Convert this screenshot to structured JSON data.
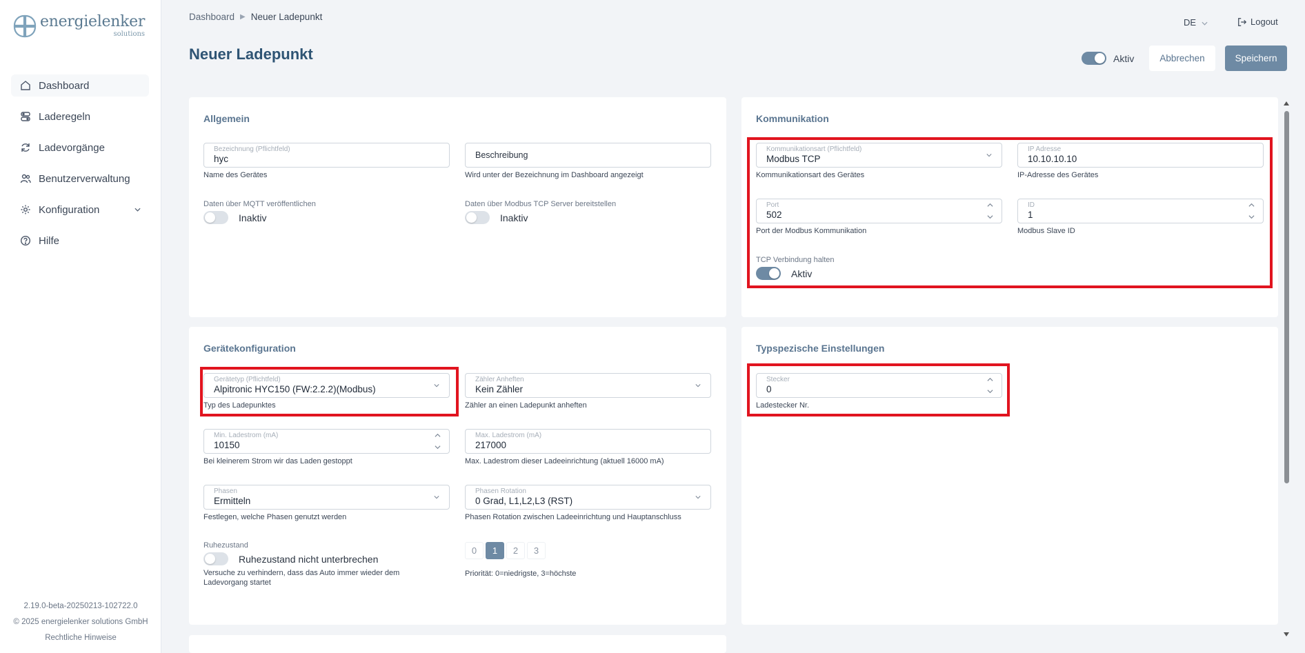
{
  "brand": {
    "name": "energielenker",
    "sub": "solutions"
  },
  "nav": [
    {
      "label": "Dashboard",
      "icon": "home-icon"
    },
    {
      "label": "Laderegeln",
      "icon": "rules-icon"
    },
    {
      "label": "Ladevorgänge",
      "icon": "refresh-icon"
    },
    {
      "label": "Benutzerverwaltung",
      "icon": "users-icon"
    },
    {
      "label": "Konfiguration",
      "icon": "gear-icon"
    },
    {
      "label": "Hilfe",
      "icon": "help-icon"
    }
  ],
  "footer": {
    "version": "2.19.0-beta-20250213-102722.0",
    "copyright": "© 2025 energielenker solutions GmbH",
    "legal": "Rechtliche Hinweise"
  },
  "breadcrumb": {
    "root": "Dashboard",
    "current": "Neuer Ladepunkt"
  },
  "header": {
    "lang": "DE",
    "logout": "Logout"
  },
  "page": {
    "title": "Neuer Ladepunkt",
    "active_label": "Aktiv",
    "cancel": "Abbrechen",
    "save": "Speichern"
  },
  "general": {
    "title": "Allgemein",
    "name": {
      "label": "Bezeichnung (Pflichtfeld)",
      "value": "hyc",
      "helper": "Name des Gerätes"
    },
    "description": {
      "placeholder": "Beschreibung",
      "helper": "Wird unter der Bezeichnung im Dashboard angezeigt"
    },
    "mqtt": {
      "label": "Daten über MQTT veröffentlichen",
      "state": "Inaktiv"
    },
    "modbus_server": {
      "label": "Daten über Modbus TCP Server bereitstellen",
      "state": "Inaktiv"
    }
  },
  "communication": {
    "title": "Kommunikation",
    "type": {
      "label": "Kommunikationsart (Pflichtfeld)",
      "value": "Modbus TCP",
      "helper": "Kommunikationsart des Gerätes"
    },
    "ip": {
      "label": "IP Adresse",
      "value": "10.10.10.10",
      "helper": "IP-Adresse des Gerätes"
    },
    "port": {
      "label": "Port",
      "value": "502",
      "helper": "Port der Modbus Kommunikation"
    },
    "id": {
      "label": "ID",
      "value": "1",
      "helper": "Modbus Slave ID"
    },
    "keep_alive": {
      "label": "TCP Verbindung halten",
      "state": "Aktiv"
    }
  },
  "device": {
    "title": "Gerätekonfiguration",
    "type": {
      "label": "Gerätetyp (Pflichtfeld)",
      "value": "Alpitronic HYC150 (FW:2.2.2)(Modbus)",
      "helper": "Typ des Ladepunktes"
    },
    "meter": {
      "label": "Zähler Anheften",
      "value": "Kein Zähler",
      "helper": "Zähler an einen Ladepunkt anheften"
    },
    "min_current": {
      "label": "Min. Ladestrom (mA)",
      "value": "10150",
      "helper": "Bei kleinerem Strom wir das Laden gestoppt"
    },
    "max_current": {
      "label": "Max. Ladestrom (mA)",
      "value": "217000",
      "helper": "Max. Ladestrom dieser Ladeeinrichtung (aktuell 16000 mA)"
    },
    "phases": {
      "label": "Phasen",
      "value": "Ermitteln",
      "helper": "Festlegen, welche Phasen genutzt werden"
    },
    "rotation": {
      "label": "Phasen Rotation",
      "value": "0 Grad, L1,L2,L3 (RST)",
      "helper": "Phasen Rotation zwischen Ladeeinrichtung und Hauptanschluss"
    },
    "rest": {
      "label": "Ruhezustand",
      "state": "Ruhezustand nicht unterbrechen",
      "helper": "Versuche zu verhindern, dass das Auto immer wieder dem Ladevorgang startet"
    },
    "priority": {
      "options": [
        "0",
        "1",
        "2",
        "3"
      ],
      "selected": "1",
      "helper": "Priorität: 0=niedrigste, 3=höchste"
    }
  },
  "typespecific": {
    "title": "Typspezische Einstellungen",
    "plug": {
      "label": "Stecker",
      "value": "0",
      "helper": "Ladestecker Nr."
    }
  },
  "colors": {
    "accent": "#6e8aa4",
    "highlight": "#e1141f",
    "title": "#2e5474"
  }
}
